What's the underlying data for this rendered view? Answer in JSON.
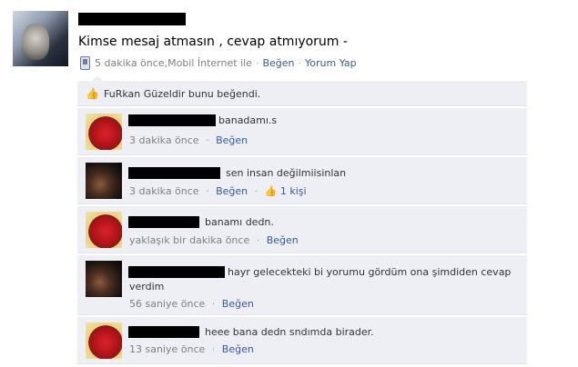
{
  "post": {
    "status_text": "Kimse mesaj atmasın , cevap atmıyorum -",
    "meta": {
      "time": "5 dakika önce",
      "via": "Mobil İnternet ile",
      "like_label": "Beğen",
      "comment_label": "Yorum Yap",
      "separator": "·"
    }
  },
  "likes": {
    "text": "FuRkan Güzeldir bunu beğendi."
  },
  "comments": [
    {
      "text": "banadamı.s",
      "time": "3 dakika önce",
      "like_label": "Beğen",
      "likes_count": ""
    },
    {
      "text": "sen insan değilmiisinlan",
      "time": "3 dakika önce",
      "like_label": "Beğen",
      "likes_count": "1 kişi"
    },
    {
      "text": "banamı dedn.",
      "time": "yaklaşık bir dakika önce",
      "like_label": "Beğen",
      "likes_count": ""
    },
    {
      "text": "hayr gelecekteki bi yorumu gördüm ona şimdiden cevap verdim",
      "time": "56 saniye önce",
      "like_label": "Beğen",
      "likes_count": ""
    },
    {
      "text": "heee bana dedn sndımda birader.",
      "time": "13 saniye önce",
      "like_label": "Beğen",
      "likes_count": ""
    }
  ],
  "icons": {
    "phone": "mobile-phone-icon",
    "like": "thumbs-up-icon"
  },
  "colors": {
    "link": "#3b5998",
    "comment_bg": "#edeff4",
    "meta_gray": "#808080"
  }
}
